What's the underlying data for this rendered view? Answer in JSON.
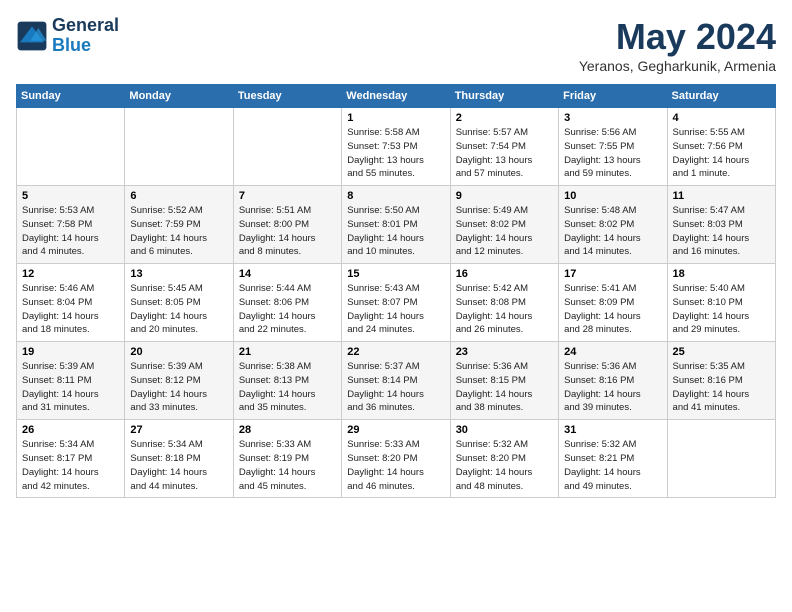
{
  "header": {
    "logo_line1": "General",
    "logo_line2": "Blue",
    "title": "May 2024",
    "location": "Yeranos, Gegharkunik, Armenia"
  },
  "days_of_week": [
    "Sunday",
    "Monday",
    "Tuesday",
    "Wednesday",
    "Thursday",
    "Friday",
    "Saturday"
  ],
  "weeks": [
    [
      {
        "day": "",
        "info": ""
      },
      {
        "day": "",
        "info": ""
      },
      {
        "day": "",
        "info": ""
      },
      {
        "day": "1",
        "info": "Sunrise: 5:58 AM\nSunset: 7:53 PM\nDaylight: 13 hours\nand 55 minutes."
      },
      {
        "day": "2",
        "info": "Sunrise: 5:57 AM\nSunset: 7:54 PM\nDaylight: 13 hours\nand 57 minutes."
      },
      {
        "day": "3",
        "info": "Sunrise: 5:56 AM\nSunset: 7:55 PM\nDaylight: 13 hours\nand 59 minutes."
      },
      {
        "day": "4",
        "info": "Sunrise: 5:55 AM\nSunset: 7:56 PM\nDaylight: 14 hours\nand 1 minute."
      }
    ],
    [
      {
        "day": "5",
        "info": "Sunrise: 5:53 AM\nSunset: 7:58 PM\nDaylight: 14 hours\nand 4 minutes."
      },
      {
        "day": "6",
        "info": "Sunrise: 5:52 AM\nSunset: 7:59 PM\nDaylight: 14 hours\nand 6 minutes."
      },
      {
        "day": "7",
        "info": "Sunrise: 5:51 AM\nSunset: 8:00 PM\nDaylight: 14 hours\nand 8 minutes."
      },
      {
        "day": "8",
        "info": "Sunrise: 5:50 AM\nSunset: 8:01 PM\nDaylight: 14 hours\nand 10 minutes."
      },
      {
        "day": "9",
        "info": "Sunrise: 5:49 AM\nSunset: 8:02 PM\nDaylight: 14 hours\nand 12 minutes."
      },
      {
        "day": "10",
        "info": "Sunrise: 5:48 AM\nSunset: 8:02 PM\nDaylight: 14 hours\nand 14 minutes."
      },
      {
        "day": "11",
        "info": "Sunrise: 5:47 AM\nSunset: 8:03 PM\nDaylight: 14 hours\nand 16 minutes."
      }
    ],
    [
      {
        "day": "12",
        "info": "Sunrise: 5:46 AM\nSunset: 8:04 PM\nDaylight: 14 hours\nand 18 minutes."
      },
      {
        "day": "13",
        "info": "Sunrise: 5:45 AM\nSunset: 8:05 PM\nDaylight: 14 hours\nand 20 minutes."
      },
      {
        "day": "14",
        "info": "Sunrise: 5:44 AM\nSunset: 8:06 PM\nDaylight: 14 hours\nand 22 minutes."
      },
      {
        "day": "15",
        "info": "Sunrise: 5:43 AM\nSunset: 8:07 PM\nDaylight: 14 hours\nand 24 minutes."
      },
      {
        "day": "16",
        "info": "Sunrise: 5:42 AM\nSunset: 8:08 PM\nDaylight: 14 hours\nand 26 minutes."
      },
      {
        "day": "17",
        "info": "Sunrise: 5:41 AM\nSunset: 8:09 PM\nDaylight: 14 hours\nand 28 minutes."
      },
      {
        "day": "18",
        "info": "Sunrise: 5:40 AM\nSunset: 8:10 PM\nDaylight: 14 hours\nand 29 minutes."
      }
    ],
    [
      {
        "day": "19",
        "info": "Sunrise: 5:39 AM\nSunset: 8:11 PM\nDaylight: 14 hours\nand 31 minutes."
      },
      {
        "day": "20",
        "info": "Sunrise: 5:39 AM\nSunset: 8:12 PM\nDaylight: 14 hours\nand 33 minutes."
      },
      {
        "day": "21",
        "info": "Sunrise: 5:38 AM\nSunset: 8:13 PM\nDaylight: 14 hours\nand 35 minutes."
      },
      {
        "day": "22",
        "info": "Sunrise: 5:37 AM\nSunset: 8:14 PM\nDaylight: 14 hours\nand 36 minutes."
      },
      {
        "day": "23",
        "info": "Sunrise: 5:36 AM\nSunset: 8:15 PM\nDaylight: 14 hours\nand 38 minutes."
      },
      {
        "day": "24",
        "info": "Sunrise: 5:36 AM\nSunset: 8:16 PM\nDaylight: 14 hours\nand 39 minutes."
      },
      {
        "day": "25",
        "info": "Sunrise: 5:35 AM\nSunset: 8:16 PM\nDaylight: 14 hours\nand 41 minutes."
      }
    ],
    [
      {
        "day": "26",
        "info": "Sunrise: 5:34 AM\nSunset: 8:17 PM\nDaylight: 14 hours\nand 42 minutes."
      },
      {
        "day": "27",
        "info": "Sunrise: 5:34 AM\nSunset: 8:18 PM\nDaylight: 14 hours\nand 44 minutes."
      },
      {
        "day": "28",
        "info": "Sunrise: 5:33 AM\nSunset: 8:19 PM\nDaylight: 14 hours\nand 45 minutes."
      },
      {
        "day": "29",
        "info": "Sunrise: 5:33 AM\nSunset: 8:20 PM\nDaylight: 14 hours\nand 46 minutes."
      },
      {
        "day": "30",
        "info": "Sunrise: 5:32 AM\nSunset: 8:20 PM\nDaylight: 14 hours\nand 48 minutes."
      },
      {
        "day": "31",
        "info": "Sunrise: 5:32 AM\nSunset: 8:21 PM\nDaylight: 14 hours\nand 49 minutes."
      },
      {
        "day": "",
        "info": ""
      }
    ]
  ]
}
